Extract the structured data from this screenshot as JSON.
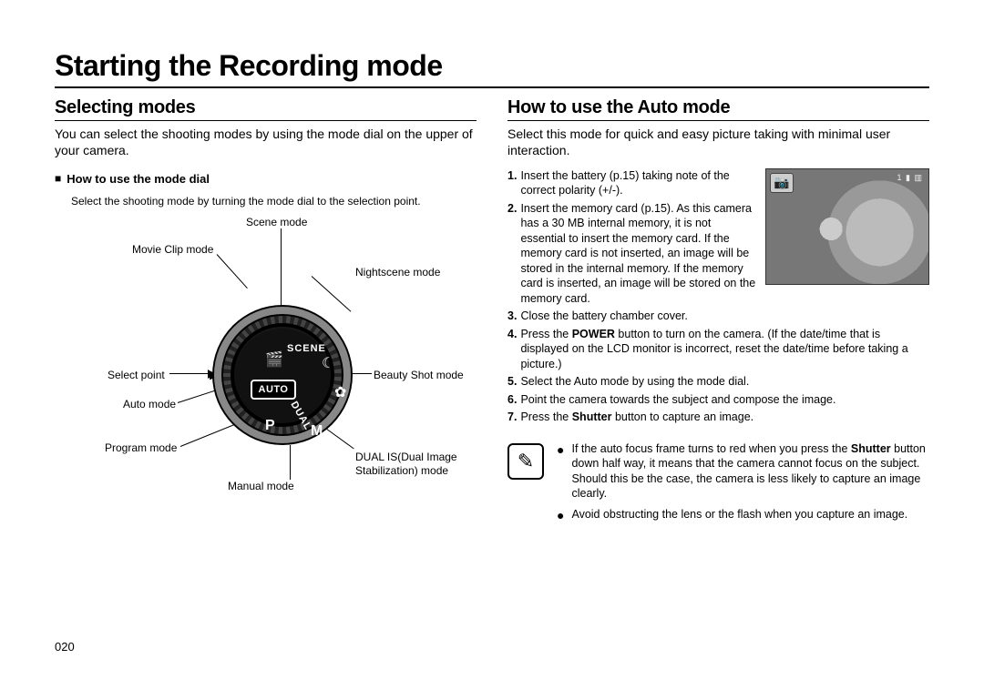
{
  "page_number": "020",
  "main_title": "Starting the Recording mode",
  "left": {
    "title": "Selecting modes",
    "intro": "You can select the shooting modes by using the mode dial on the upper of your camera.",
    "sub_heading": "How to use the mode dial",
    "sub_desc": "Select the shooting mode by turning the mode dial to the selection point.",
    "dial_labels": {
      "scene": "Scene mode",
      "movie": "Movie Clip mode",
      "night": "Nightscene mode",
      "select_point": "Select point",
      "beauty": "Beauty Shot mode",
      "auto": "Auto mode",
      "program": "Program mode",
      "dual_is": "DUAL IS(Dual Image Stabilization) mode",
      "manual": "Manual mode"
    },
    "dial_face": {
      "auto_badge": "AUTO",
      "scene_text": "SCENE",
      "dual_text": "DUAL",
      "m": "M",
      "p": "P"
    }
  },
  "right": {
    "title": "How to use the Auto mode",
    "intro": "Select this mode for quick and easy picture taking with minimal user interaction.",
    "lcd": {
      "icon_name": "camera-icon",
      "top_right": "1 ▮ ▥"
    },
    "steps": [
      {
        "n": "1.",
        "text": "Insert the battery (p.15) taking note of the correct polarity (+/-)."
      },
      {
        "n": "2.",
        "text": "Insert the memory card (p.15). As this camera has a 30 MB internal memory, it is not essential to insert the memory card. If the memory card is not inserted, an image will be stored in the internal memory. If the memory card is inserted, an image will be stored on the memory card."
      },
      {
        "n": "3.",
        "text": "Close the battery chamber cover."
      },
      {
        "n": "4.",
        "text_html": "Press the <b>POWER</b> button to turn on the camera. (If the date/time that is displayed on the LCD monitor is incorrect, reset the date/time before taking a picture.)"
      },
      {
        "n": "5.",
        "text": "Select the Auto mode by using the mode dial."
      },
      {
        "n": "6.",
        "text": "Point the camera towards the subject and compose the image."
      },
      {
        "n": "7.",
        "text_html": "Press the <b>Shutter</b> button to capture an image."
      }
    ],
    "notes": [
      {
        "text_html": "If the auto focus frame turns to red when you press the <b>Shutter</b> button down half way, it means that the camera cannot focus on the subject. Should this be the case, the camera is less likely to capture an image clearly."
      },
      {
        "text": "Avoid obstructing the lens or the flash when you capture an image."
      }
    ]
  }
}
